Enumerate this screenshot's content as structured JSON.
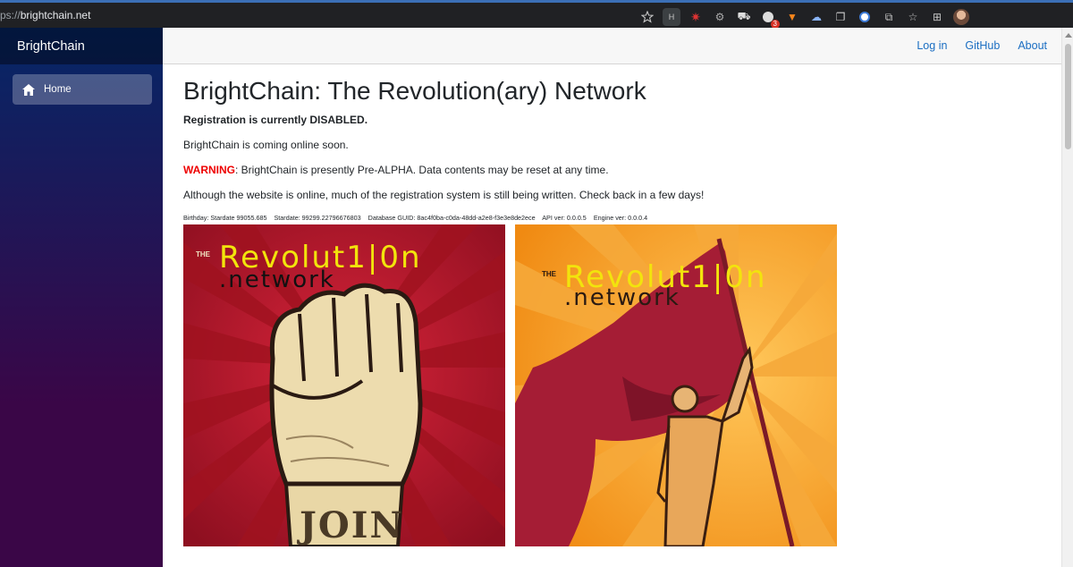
{
  "browser": {
    "url_scheme": "ps://",
    "url_host": "brightchain.net",
    "extension_badge": "3",
    "extensions": [
      "star-add-icon",
      "extension-h-icon",
      "extension-bug-icon",
      "extension-gear-icon",
      "extension-car-icon",
      "extension-red-icon",
      "metamask-icon",
      "extension-cloud-icon",
      "extension-squares-icon",
      "extension-globe-icon",
      "extensions-puzzle-icon",
      "favorites-icon",
      "collections-icon",
      "profile-avatar"
    ]
  },
  "sidebar": {
    "brand": "BrightChain",
    "nav": [
      {
        "label": "Home",
        "icon": "home-icon"
      }
    ]
  },
  "top_row": {
    "links": [
      "Log in",
      "GitHub",
      "About"
    ]
  },
  "main": {
    "title": "BrightChain: The Revolution(ary) Network",
    "registration": "Registration is currently DISABLED.",
    "online_soon": "BrightChain is coming online soon.",
    "warning_label": "WARNING",
    "warning_text": ": BrightChain is presently Pre-ALPHA. Data contents may be reset at any time.",
    "note": "Although the website is online, much of the registration system is still being written. Check back in a few days!",
    "meta": {
      "birthday": "Birthday: Stardate 99055.685",
      "stardate": "Stardate: 99299.22796676803",
      "guid": "Database GUID: 8ac4f0ba-c0da-48dd-a2e8-f3e3e8de2ece",
      "api": "API ver: 0.0.0.5",
      "engine": "Engine ver: 0.0.0.4"
    }
  },
  "posters": [
    {
      "the": "THE",
      "word_a": "Revolut",
      "word_b": "1|0",
      "word_c": "n",
      "network": ".network",
      "caption": "JOIN"
    },
    {
      "the": "THE",
      "word_a": "Revolut",
      "word_b": "1|0",
      "word_c": "n",
      "network": ".network"
    }
  ],
  "colors": {
    "sidebar_top": "#052767",
    "sidebar_bottom": "#3a0647",
    "link": "#1b6ec2",
    "warning": "#ee0000",
    "poster_red": "#b3162a",
    "poster_orange": "#f59a1b",
    "poster_yellow": "#f2e40c"
  }
}
